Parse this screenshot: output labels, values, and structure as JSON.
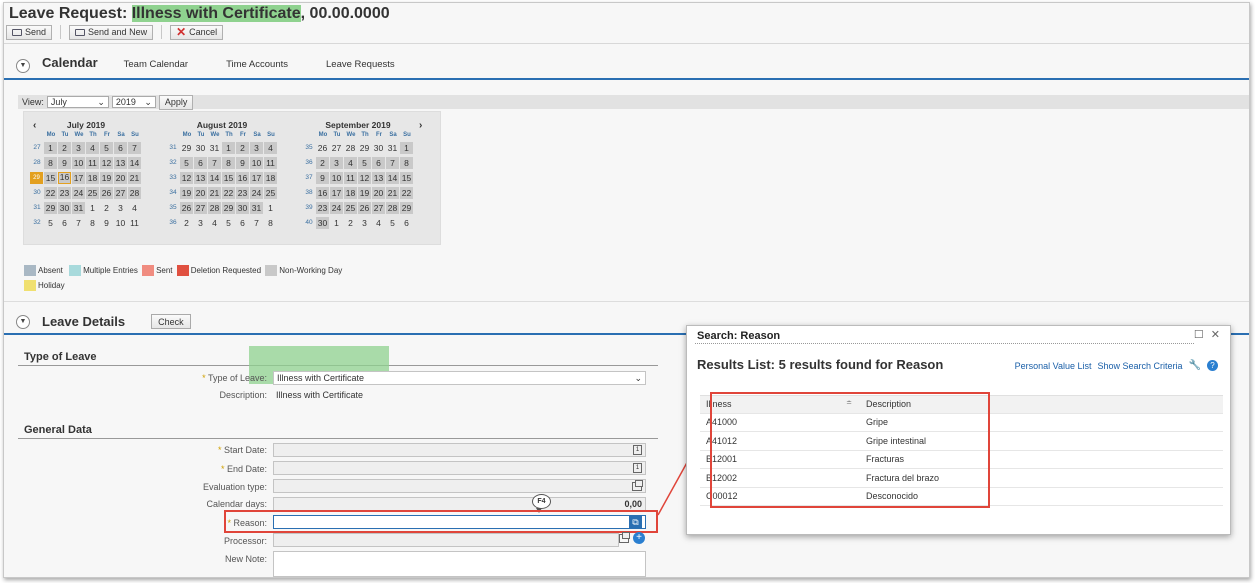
{
  "window": {
    "title_prefix": "Leave Request: ",
    "title_highlight": "Illness with Certificate",
    "title_suffix": ", 00.00.0000"
  },
  "toolbar": {
    "send": "Send",
    "send_new": "Send and New",
    "cancel": "Cancel"
  },
  "tabs": {
    "active": "Calendar",
    "items": [
      "Team Calendar",
      "Time Accounts",
      "Leave Requests"
    ]
  },
  "view_bar": {
    "label": "View:",
    "month": "July",
    "year": "2019",
    "apply": "Apply"
  },
  "calendar": {
    "dow": [
      "Mo",
      "Tu",
      "We",
      "Th",
      "Fr",
      "Sa",
      "Su"
    ],
    "months": [
      {
        "title": "July 2019",
        "weeks": [
          {
            "wn": "27",
            "days": [
              "1",
              "2",
              "3",
              "4",
              "5",
              "6",
              "7"
            ]
          },
          {
            "wn": "28",
            "days": [
              "8",
              "9",
              "10",
              "11",
              "12",
              "13",
              "14"
            ]
          },
          {
            "wn": "29",
            "days": [
              "15",
              "16",
              "17",
              "18",
              "19",
              "20",
              "21"
            ]
          },
          {
            "wn": "30",
            "days": [
              "22",
              "23",
              "24",
              "25",
              "26",
              "27",
              "28"
            ]
          },
          {
            "wn": "31",
            "days": [
              "29",
              "30",
              "31",
              "1",
              "2",
              "3",
              "4"
            ]
          },
          {
            "wn": "32",
            "days": [
              "5",
              "6",
              "7",
              "8",
              "9",
              "10",
              "11"
            ]
          }
        ]
      },
      {
        "title": "August 2019",
        "weeks": [
          {
            "wn": "31",
            "days": [
              "29",
              "30",
              "31",
              "1",
              "2",
              "3",
              "4"
            ]
          },
          {
            "wn": "32",
            "days": [
              "5",
              "6",
              "7",
              "8",
              "9",
              "10",
              "11"
            ]
          },
          {
            "wn": "33",
            "days": [
              "12",
              "13",
              "14",
              "15",
              "16",
              "17",
              "18"
            ]
          },
          {
            "wn": "34",
            "days": [
              "19",
              "20",
              "21",
              "22",
              "23",
              "24",
              "25"
            ]
          },
          {
            "wn": "35",
            "days": [
              "26",
              "27",
              "28",
              "29",
              "30",
              "31",
              "1"
            ]
          },
          {
            "wn": "36",
            "days": [
              "2",
              "3",
              "4",
              "5",
              "6",
              "7",
              "8"
            ]
          }
        ]
      },
      {
        "title": "September 2019",
        "weeks": [
          {
            "wn": "35",
            "days": [
              "26",
              "27",
              "28",
              "29",
              "30",
              "31",
              "1"
            ]
          },
          {
            "wn": "36",
            "days": [
              "2",
              "3",
              "4",
              "5",
              "6",
              "7",
              "8"
            ]
          },
          {
            "wn": "37",
            "days": [
              "9",
              "10",
              "11",
              "12",
              "13",
              "14",
              "15"
            ]
          },
          {
            "wn": "38",
            "days": [
              "16",
              "17",
              "18",
              "19",
              "20",
              "21",
              "22"
            ]
          },
          {
            "wn": "39",
            "days": [
              "23",
              "24",
              "25",
              "26",
              "27",
              "28",
              "29"
            ]
          },
          {
            "wn": "40",
            "days": [
              "30",
              "1",
              "2",
              "3",
              "4",
              "5",
              "6"
            ]
          }
        ]
      }
    ],
    "selected_week_label": "29",
    "today_day": "16"
  },
  "legend": {
    "absent": "Absent",
    "multiple": "Multiple Entries",
    "sent": "Sent",
    "deletion": "Deletion Requested",
    "non_working": "Non-Working Day",
    "holiday": "Holiday",
    "colors": {
      "absent": "#a9b8c4",
      "multiple": "#a8dadc",
      "sent": "#f08c80",
      "deletion": "#e05040",
      "non_working": "#c9c9c9",
      "holiday": "#f0e070"
    }
  },
  "leave_details": {
    "title": "Leave Details",
    "check": "Check",
    "type_group": "Type of Leave",
    "type_label": "Type of Leave:",
    "type_value": "Illness with Certificate",
    "desc_label": "Description:",
    "desc_value": "Illness with Certificate",
    "general_group": "General Data",
    "start_label": "Start Date:",
    "end_label": "End Date:",
    "eval_label": "Evaluation type:",
    "caldays_label": "Calendar days:",
    "caldays_value": "0,00",
    "reason_label": "Reason:",
    "processor_label": "Processor:",
    "note_label": "New Note:",
    "f4_label": "F4"
  },
  "search_popup": {
    "title": "Search: Reason",
    "results_title": "Results List: 5 results found for Reason",
    "link_personal": "Personal Value List",
    "link_show": "Show Search Criteria",
    "columns": [
      "Illness",
      "Description"
    ],
    "rows": [
      {
        "code": "A41000",
        "desc": "Gripe"
      },
      {
        "code": "A41012",
        "desc": "Gripe intestinal"
      },
      {
        "code": "B12001",
        "desc": "Fracturas"
      },
      {
        "code": "B12002",
        "desc": "Fractura del brazo"
      },
      {
        "code": "C00012",
        "desc": "Desconocido"
      }
    ]
  },
  "colors": {
    "accent_blue": "#2a6fb2",
    "highlight_green": "#8fd28f",
    "callout_red": "#e0453a",
    "today_orange": "#e3a020"
  }
}
